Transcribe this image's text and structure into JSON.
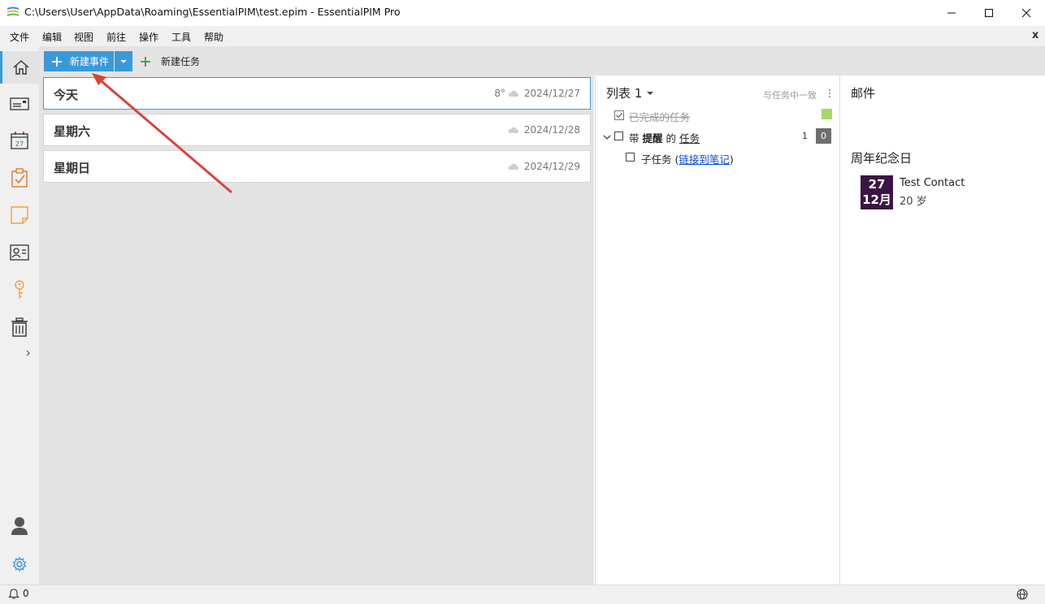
{
  "window": {
    "title": "C:\\Users\\User\\AppData\\Roaming\\EssentialPIM\\test.epim - EssentialPIM Pro"
  },
  "menu": [
    "文件",
    "编辑",
    "视图",
    "前往",
    "操作",
    "工具",
    "帮助"
  ],
  "menu_close": "x",
  "nav": {
    "items": [
      "home-icon",
      "mail-icon",
      "calendar-icon",
      "tasks-icon",
      "notes-icon",
      "contacts-icon",
      "passwords-icon",
      "trash-icon",
      "expand-icon",
      "user-icon",
      "settings-icon"
    ],
    "calendar_day": "27"
  },
  "toolbar": {
    "new_event": "新建事件",
    "new_task": "新建任务"
  },
  "days": [
    {
      "name": "今天",
      "temp": "8°",
      "date": "2024/12/27"
    },
    {
      "name": "星期六",
      "temp": "",
      "date": "2024/12/28"
    },
    {
      "name": "星期日",
      "temp": "",
      "date": "2024/12/29"
    }
  ],
  "tasks": {
    "list_title": "列表 1",
    "sync_label": "与任务中一致",
    "completed_label": "已完成的任务",
    "task1": {
      "prefix": "带 ",
      "bold": "提醒",
      "middle": " 的 ",
      "underlined": "任务",
      "count": "1",
      "badge": "0"
    },
    "subtask": {
      "label": "子任务 (",
      "link": "链接到笔记",
      "suffix": ")"
    }
  },
  "mail": {
    "title": "邮件"
  },
  "anniversary": {
    "title": "周年纪念日",
    "day": "27",
    "month": "12月",
    "contact": "Test Contact",
    "age": "20 岁"
  },
  "status": {
    "bell_count": "0"
  },
  "colors": {
    "accent": "#3a9ad9",
    "anniversary_bg": "#3b1443",
    "completed_swatch": "#a6d96a",
    "arrow": "#d9433b"
  }
}
